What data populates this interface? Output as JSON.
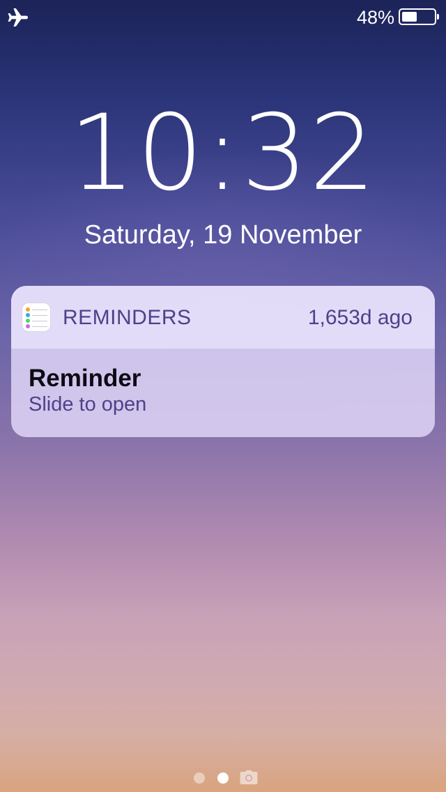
{
  "status_bar": {
    "airplane_icon": "airplane-icon",
    "battery_percent": "48%",
    "battery_level": 0.48
  },
  "lock_screen": {
    "time": "10:32",
    "date": "Saturday, 19 November"
  },
  "notification": {
    "app_icon": "reminders-app-icon",
    "app_name": "REMINDERS",
    "time_ago": "1,653d ago",
    "title": "Reminder",
    "subtitle": "Slide to open"
  },
  "page_indicator": {
    "pages": 2,
    "active_page": 2,
    "camera_icon": "camera-icon"
  },
  "colors": {
    "notification_text": "#4e418a",
    "title_text": "#0c0a14",
    "background_top": "#1c2358",
    "background_bottom": "#d9a47e"
  }
}
